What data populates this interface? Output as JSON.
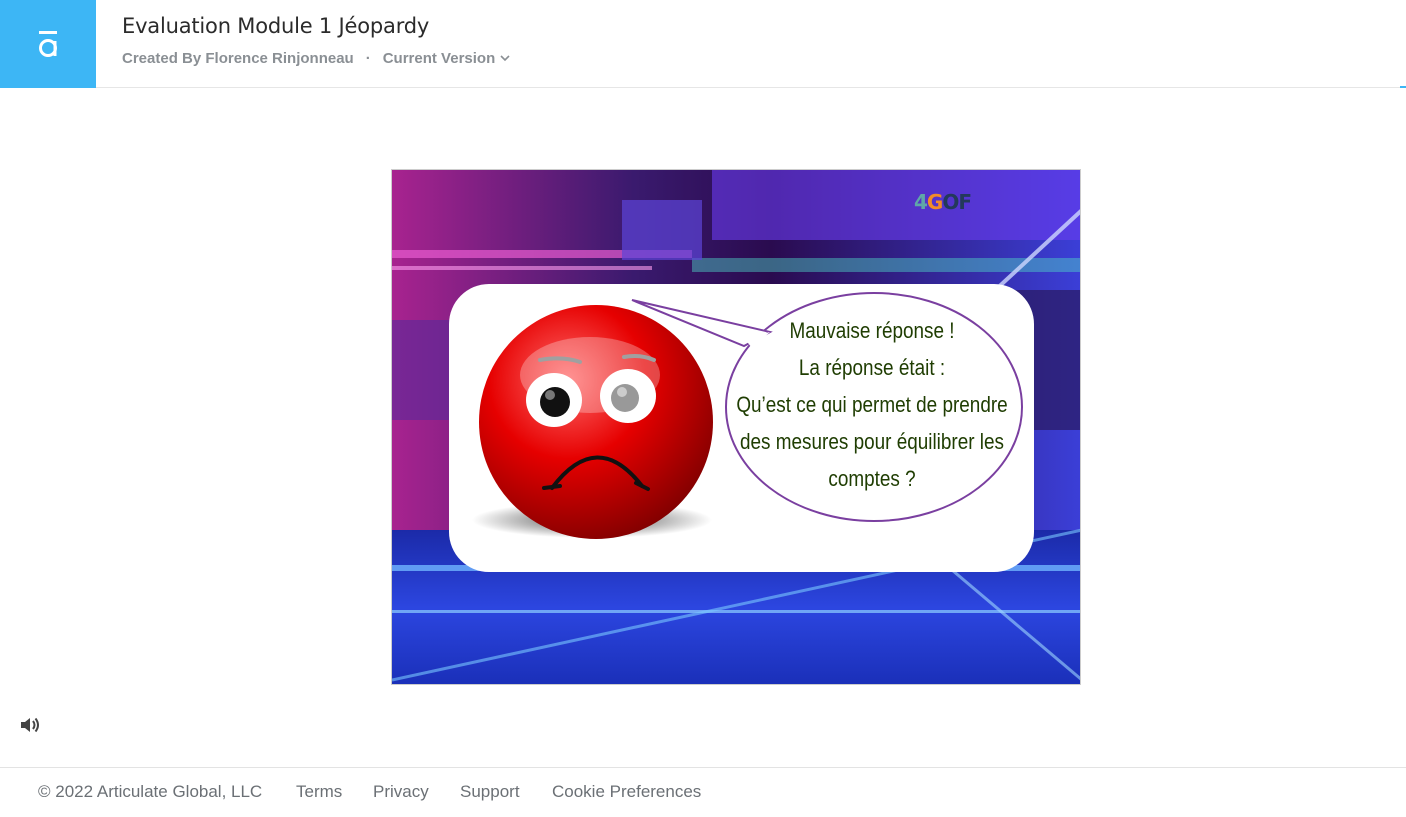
{
  "header": {
    "title": "Evaluation Module 1 Jéopardy",
    "created_by": "Created By Florence Rinjonneau",
    "separator": "·",
    "version_label": "Current Version",
    "logo_icon": "articulate-logo-icon",
    "brand_color": "#3db6f5"
  },
  "slide": {
    "brand": {
      "part1": "4",
      "part2": "G",
      "part3": "OF"
    },
    "message": [
      "Mauvaise réponse !",
      "La réponse était :",
      "Qu’est ce qui permet de prendre",
      "des mesures pour équilibrer les",
      "comptes ?"
    ]
  },
  "audio": {
    "icon": "speaker-icon"
  },
  "footer": {
    "copyright": "© 2022 Articulate Global, LLC",
    "links": [
      "Terms",
      "Privacy",
      "Support",
      "Cookie Preferences"
    ]
  }
}
